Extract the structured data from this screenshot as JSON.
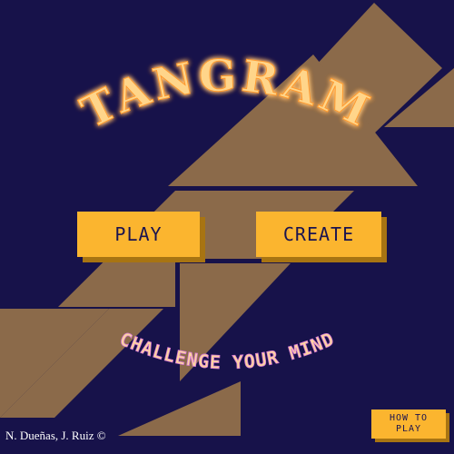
{
  "title": "TANGRAM",
  "tagline": "CHALLENGE YOUR MIND",
  "buttons": {
    "play": "PLAY",
    "create": "CREATE",
    "how_to_play_line1": "HOW TO",
    "how_to_play_line2": "PLAY"
  },
  "credits": "N. Dueñas, J. Ruiz ©",
  "colors": {
    "background": "#17124a",
    "tangram_piece": "#8b6a4a",
    "button": "#fbb52f",
    "button_shadow": "#a87412",
    "title_glow": "#ffb347"
  }
}
